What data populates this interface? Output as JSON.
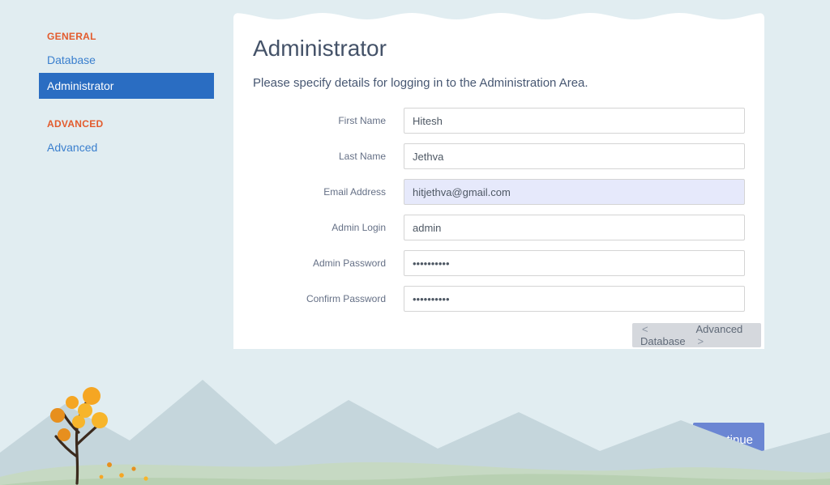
{
  "sidebar": {
    "sections": [
      {
        "header": "GENERAL",
        "items": [
          {
            "label": "Database",
            "key": "database",
            "active": false
          },
          {
            "label": "Administrator",
            "key": "administrator",
            "active": true
          }
        ]
      },
      {
        "header": "ADVANCED",
        "items": [
          {
            "label": "Advanced",
            "key": "advanced",
            "active": false
          }
        ]
      }
    ]
  },
  "main": {
    "title": "Administrator",
    "subtitle": "Please specify details for logging in to the Administration Area.",
    "fields": {
      "first_name": {
        "label": "First Name",
        "value": "Hitesh"
      },
      "last_name": {
        "label": "Last Name",
        "value": "Jethva"
      },
      "email": {
        "label": "Email Address",
        "value": "hitjethva@gmail.com"
      },
      "admin_login": {
        "label": "Admin Login",
        "value": "admin"
      },
      "admin_password": {
        "label": "Admin Password",
        "value": "••••••••••"
      },
      "confirm_password": {
        "label": "Confirm Password",
        "value": "••••••••••"
      }
    }
  },
  "nav": {
    "prev": "Database",
    "next": "Advanced",
    "left_arrow": "<",
    "right_arrow": ">"
  },
  "footer": {
    "continue": "Continue"
  }
}
